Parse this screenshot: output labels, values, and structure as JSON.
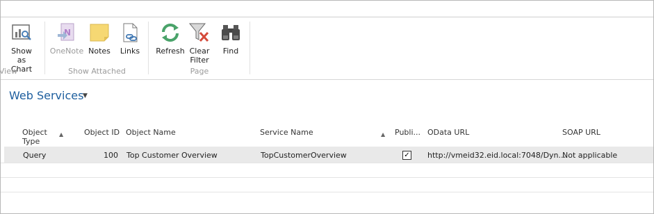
{
  "ribbon": {
    "buttons": [
      {
        "label": "Show as Chart",
        "icon": "chart-icon"
      },
      {
        "label": "OneNote",
        "icon": "onenote-icon"
      },
      {
        "label": "Notes",
        "icon": "notes-icon"
      },
      {
        "label": "Links",
        "icon": "links-icon"
      },
      {
        "label": "Refresh",
        "icon": "refresh-icon"
      },
      {
        "label": "Clear Filter",
        "icon": "clear-filter-icon"
      },
      {
        "label": "Find",
        "icon": "binoculars-icon"
      }
    ],
    "groups": [
      "View",
      "Show Attached",
      "Page"
    ]
  },
  "page": {
    "title": "Web Services"
  },
  "table": {
    "columns": [
      "Object Type",
      "Object ID",
      "Object Name",
      "Service Name",
      "Publi...",
      "OData URL",
      "SOAP URL"
    ],
    "rows": [
      {
        "object_type": "Query",
        "object_id": "100",
        "object_name": "Top Customer Overview",
        "service_name": "TopCustomerOverview",
        "published": true,
        "odata_url": "http://vmeid32.eid.local:7048/Dyn...",
        "soap_url": "Not applicable"
      }
    ]
  },
  "colors": {
    "accent": "#1d5e9e",
    "selected_row": "#e9e9e9"
  }
}
